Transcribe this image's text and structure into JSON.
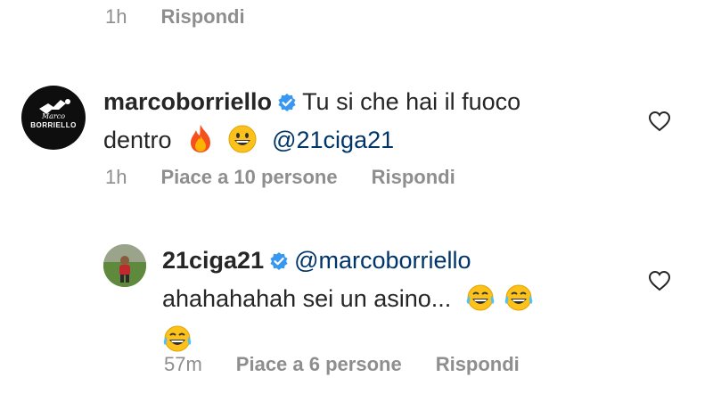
{
  "top_meta": {
    "time": "1h",
    "reply_label": "Rispondi"
  },
  "comment1": {
    "avatar_text_top": "Marco",
    "avatar_text_bottom": "BORRIELLO",
    "username": "marcoborriello",
    "text_line1": "Tu si che hai il fuoco",
    "text_line2": "dentro",
    "mention": "@21ciga21",
    "time": "1h",
    "likes_label": "Piace a 10 persone",
    "reply_label": "Rispondi"
  },
  "comment2": {
    "username": "21ciga21",
    "mention": "@marcoborriello",
    "text": "ahahahahah sei un asino...",
    "time": "57m",
    "likes_label": "Piace a 6 persone",
    "reply_label": "Rispondi"
  },
  "colors": {
    "secondary_text": "#8e8e8e",
    "mention": "#003569",
    "verified": "#3897f0"
  }
}
